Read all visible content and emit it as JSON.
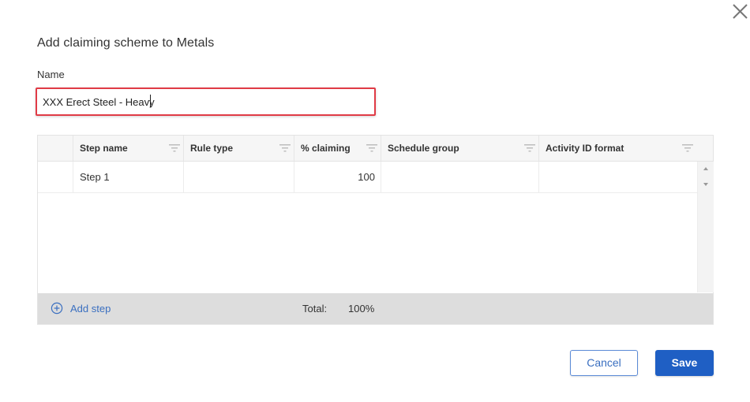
{
  "dialog": {
    "title": "Add claiming scheme to Metals",
    "close_icon": "close-icon"
  },
  "name_field": {
    "label": "Name",
    "value": "XXX Erect Steel - Heavy",
    "highlight_color": "#e03b46"
  },
  "grid": {
    "columns": [
      {
        "label": "Step name",
        "icon": "filter-icon"
      },
      {
        "label": "Rule type",
        "icon": "filter-icon"
      },
      {
        "label": "% claiming",
        "icon": "filter-icon"
      },
      {
        "label": "Schedule group",
        "icon": "filter-icon"
      },
      {
        "label": "Activity ID format",
        "icon": "filter-icon"
      }
    ],
    "rows": [
      {
        "step_name": "Step 1",
        "rule_type": "",
        "percent_claiming": "100",
        "schedule_group": "",
        "activity_id_format": ""
      }
    ],
    "footer": {
      "add_step_label": "Add step",
      "add_icon": "plus-circle-icon",
      "total_label": "Total:",
      "total_value": "100%"
    }
  },
  "actions": {
    "cancel_label": "Cancel",
    "save_label": "Save"
  },
  "colors": {
    "accent": "#1f5fc4",
    "link": "#3a6fc0",
    "footer_bg": "#dddddd"
  }
}
